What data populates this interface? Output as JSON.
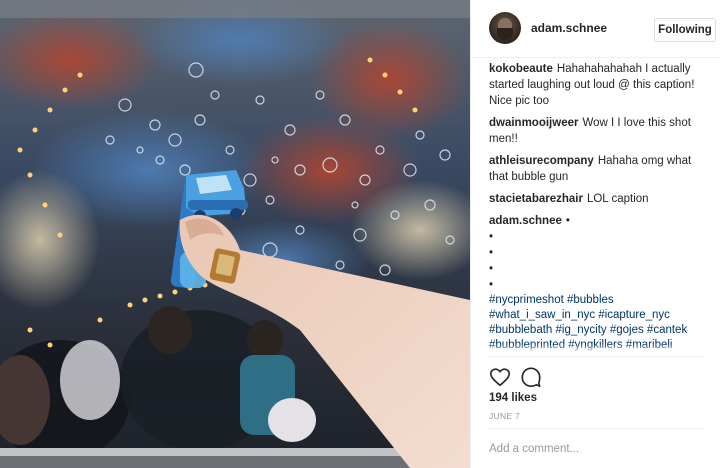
{
  "post": {
    "username": "adam.schnee",
    "follow_label": "Following"
  },
  "comments": [
    {
      "user": "kokobeaute",
      "text": "Hahahahahahah I actually started laughing out loud @ this caption! Nice pic too"
    },
    {
      "user": "dwainmooijweer",
      "text": "Wow I I love this shot men!!"
    },
    {
      "user": "athleisurecompany",
      "text": "Hahaha omg what that bubble gun"
    },
    {
      "user": "stacietabarezhair",
      "text": "LOL caption"
    }
  ],
  "caption": {
    "user": "adam.schnee",
    "first_line": "•",
    "dots": [
      "•",
      "•",
      "•",
      "•"
    ],
    "hashtags": "#nycprimeshot #bubbles #what_i_saw_in_nyc #icapture_nyc #bubblebath #ig_nycity #gojes #cantek #bubbleprinted #yngkillers #maribeli #bathbomb #swearnet #onlinebiz #citykillerz #kamijual #lushcosmetics #mkexplore #streetmobs #bath"
  },
  "likes": "194 likes",
  "date": "JUNE 7",
  "add_comment_placeholder": "Add a comment...",
  "icons": {
    "like": "heart-icon",
    "comment": "comment-bubble-icon"
  }
}
